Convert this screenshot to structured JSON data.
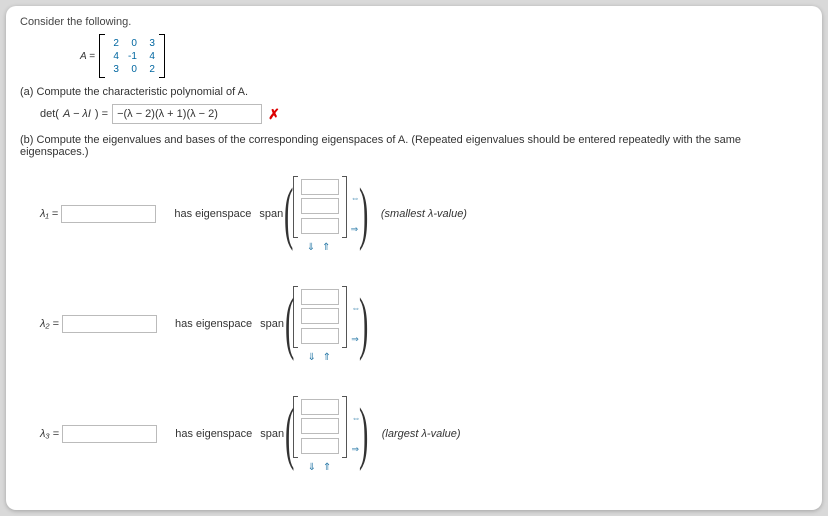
{
  "prompt": "Consider the following.",
  "matrix": {
    "label": "A =",
    "rows": [
      [
        "2",
        "0",
        "3"
      ],
      [
        "4",
        "-1",
        "4"
      ],
      [
        "3",
        "0",
        "2"
      ]
    ]
  },
  "partA": {
    "label": "(a)  Compute the characteristic polynomial of A.",
    "detlabel_pre": "det(",
    "detlabel_mid": "A − λI",
    "detlabel_post": ") =",
    "answer": "−(λ − 2)(λ + 1)(λ − 2)",
    "mark": "✗"
  },
  "partB": {
    "label": "(b)  Compute the eigenvalues and bases of the corresponding eigenspaces of A. (Repeated eigenvalues should be entered repeatedly with the same eigenspaces.)",
    "rows": [
      {
        "lambda": "λ₁",
        "eq": "=",
        "has": "has eigenspace",
        "span": "span",
        "hint": "(smallest λ-value)"
      },
      {
        "lambda": "λ₂",
        "eq": "=",
        "has": "has eigenspace",
        "span": "span",
        "hint": ""
      },
      {
        "lambda": "λ₃",
        "eq": "=",
        "has": "has eigenspace",
        "span": "span",
        "hint": "(largest λ-value)"
      }
    ],
    "arrows_side": [
      "⇔",
      "⇒"
    ],
    "arrows_bottom": "⇓ ⇑"
  }
}
